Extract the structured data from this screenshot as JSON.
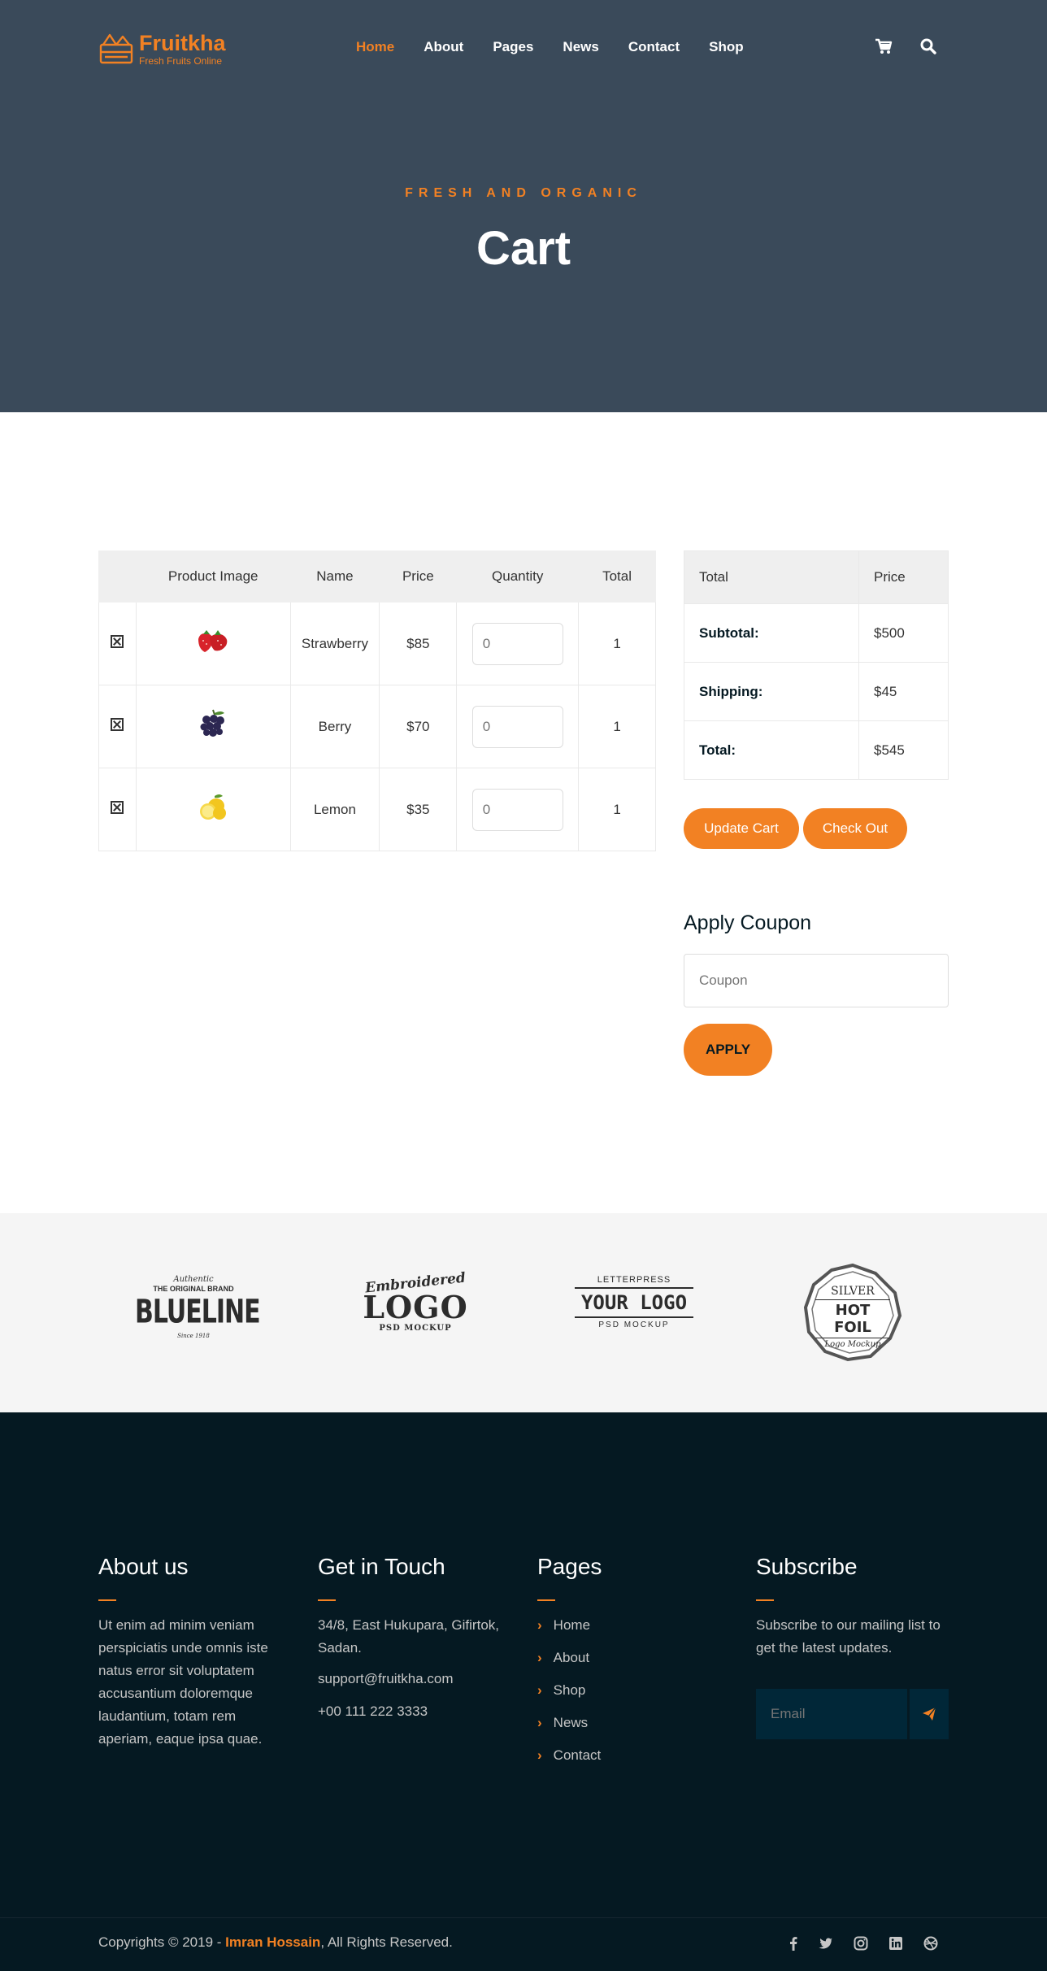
{
  "header": {
    "brand": {
      "name": "Fruitkha",
      "tagline": "Fresh Fruits Online"
    },
    "nav": [
      "Home",
      "About",
      "Pages",
      "News",
      "Contact",
      "Shop"
    ],
    "icons": [
      "cart-icon",
      "search-icon"
    ]
  },
  "hero": {
    "subtitle": "FRESH AND ORGANIC",
    "title": "Cart"
  },
  "cart": {
    "headers": [
      "",
      "Product Image",
      "Name",
      "Price",
      "Quantity",
      "Total"
    ],
    "rows": [
      {
        "name": "Strawberry",
        "price": "$85",
        "qty_placeholder": "0",
        "total": "1",
        "image": "strawberry"
      },
      {
        "name": "Berry",
        "price": "$70",
        "qty_placeholder": "0",
        "total": "1",
        "image": "berry"
      },
      {
        "name": "Lemon",
        "price": "$35",
        "qty_placeholder": "0",
        "total": "1",
        "image": "lemon"
      }
    ]
  },
  "totals": {
    "headers": [
      "Total",
      "Price"
    ],
    "rows": [
      {
        "label": "Subtotal:",
        "value": "$500"
      },
      {
        "label": "Shipping:",
        "value": "$45"
      },
      {
        "label": "Total:",
        "value": "$545"
      }
    ],
    "update_label": "Update Cart",
    "checkout_label": "Check Out"
  },
  "coupon": {
    "title": "Apply Coupon",
    "placeholder": "Coupon",
    "apply_label": "APPLY"
  },
  "brands": [
    {
      "top": "Authentic",
      "line1": "THE ORIGINAL BRAND",
      "main": "BLUELINE",
      "bottom": "Since 1918"
    },
    {
      "top": "Embroidered",
      "main": "LOGO",
      "bottom": "PSD MOCKUP"
    },
    {
      "top": "LETTERPRESS",
      "main": "YOUR LOGO",
      "bottom": "PSD MOCKUP"
    },
    {
      "top": "SILVER",
      "main": "HOT FOIL",
      "bottom": "Logo Mockup"
    }
  ],
  "footer": {
    "about": {
      "title": "About us",
      "text": "Ut enim ad minim veniam perspiciatis unde omnis iste natus error sit voluptatem accusantium doloremque laudantium, totam rem aperiam, eaque ipsa quae."
    },
    "contact": {
      "title": "Get in Touch",
      "address": "34/8, East Hukupara, Gifirtok, Sadan.",
      "email": "support@fruitkha.com",
      "phone": "+00 111 222 3333"
    },
    "pages": {
      "title": "Pages",
      "links": [
        "Home",
        "About",
        "Shop",
        "News",
        "Contact"
      ]
    },
    "subscribe": {
      "title": "Subscribe",
      "text": "Subscribe to our mailing list to get the latest updates.",
      "placeholder": "Email"
    },
    "copyright": {
      "prefix": "Copyrights © 2019 - ",
      "author": "Imran Hossain",
      "suffix": ", All Rights Reserved."
    },
    "social": [
      "facebook-icon",
      "twitter-icon",
      "instagram-icon",
      "linkedin-icon",
      "dribbble-icon"
    ]
  },
  "colors": {
    "accent": "#F28123",
    "hero_bg": "#3a4a5a",
    "footer_bg": "#051922"
  }
}
